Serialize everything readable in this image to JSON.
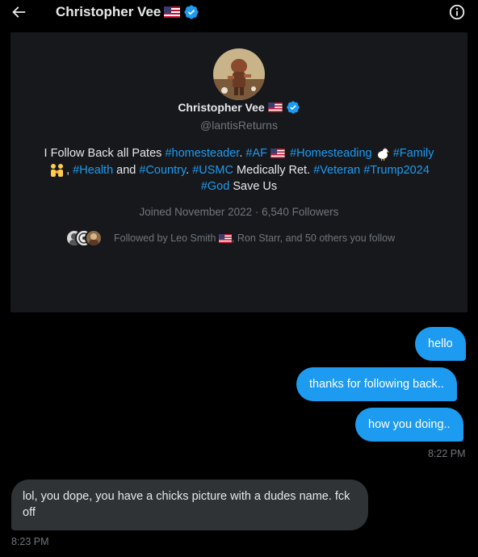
{
  "header": {
    "title": "Christopher Vee",
    "flag": "US flag",
    "verified": true
  },
  "profile": {
    "name": "Christopher Vee",
    "handle": "@lantisReturns",
    "bio": {
      "t1": "I Follow Back all Pates ",
      "h1": "#homesteader",
      "t2": ". ",
      "h2": "#AF",
      "t3": " ",
      "h3": "#Homesteading",
      "h4": "#Family",
      "t4": ", ",
      "h5": "#Health",
      "t5": " and ",
      "h6": "#Country",
      "t6": ". ",
      "h7": "#USMC",
      "t7": " Medically Ret. ",
      "h8": "#Veteran",
      "t8": " ",
      "h9": "#Trump2024",
      "h10": "#God",
      "t9": " Save Us"
    },
    "joined": "Joined November 2022 · 6,540 Followers",
    "followed_a": "Followed by Leo Smith",
    "followed_b": ", Ron Starr, and 50 others you follow"
  },
  "messages": [
    {
      "direction": "out",
      "text": "hello"
    },
    {
      "direction": "out",
      "text": "thanks for following back.."
    },
    {
      "direction": "out",
      "text": "how you doing.."
    },
    {
      "direction": "in",
      "text": "lol, you dope, you have a chicks picture with a dudes name. fck off"
    }
  ],
  "timestamps": {
    "sent": "8:22 PM",
    "received": "8:23 PM"
  },
  "colors": {
    "accent": "#1d9bf0",
    "background": "#000000",
    "card": "#16181c",
    "incoming_bubble": "#2f3336",
    "muted_text": "#71767b"
  }
}
